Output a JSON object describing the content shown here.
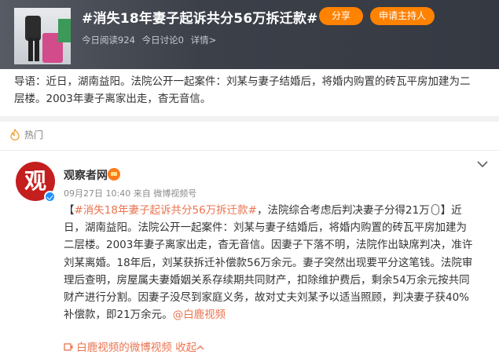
{
  "header": {
    "topic_title": "#消失18年妻子起诉共分56万拆迁款#",
    "read_label": "今日阅读924",
    "discuss_label": "今日讨论0",
    "detail_label": "详情>",
    "share_label": "分享",
    "apply_host_label": "申请主持人",
    "accent_color": "#ff8200"
  },
  "intro": {
    "text_line1": "导语：近日，湖南益阳。法院公开一起案件：刘某与妻子结婚后，将婚内购置的砖瓦平房加建为二",
    "text_line2": "层楼。2003年妻子离家出走，杳无音信。"
  },
  "feed": {
    "section_label": "热门",
    "section_icon": "fire-icon",
    "post": {
      "avatar_char": "观",
      "username": "观察者网",
      "time": "09月27日 10:40",
      "source": "来自 微博视频号",
      "hashtag": "#消失18年妻子起诉共分56万拆迁款#",
      "line1_rest": "，法院综合考虑后判决妻子分得21万",
      "line1_tail": "】近",
      "line2": "日，湖南益阳。法院公开一起案件：刘某与妻子结婚后，将婚内购置的砖瓦平房加建为",
      "line3": "二层楼。2003年妻子离家出走，杳无音信。因妻子下落不明，法院作出缺席判决，准许",
      "line4": "刘某离婚。18年后，刘某获拆迁补偿款56万余元。妻子突然出现要平分这笔钱。法院审",
      "line5": "理后查明，房屋属夫妻婚姻关系存续期共同财产，扣除维护费后，剩余54万余元按共同",
      "line6": "财产进行分割。因妻子没尽到家庭义务，故对丈夫刘某予以适当照顾，判决妻子获40%",
      "line7_text": "补偿款，即21万余元。",
      "line7_mention": "@白鹿视频",
      "video_label": "白鹿视频的微博视频",
      "collapse_label": "收起"
    }
  }
}
